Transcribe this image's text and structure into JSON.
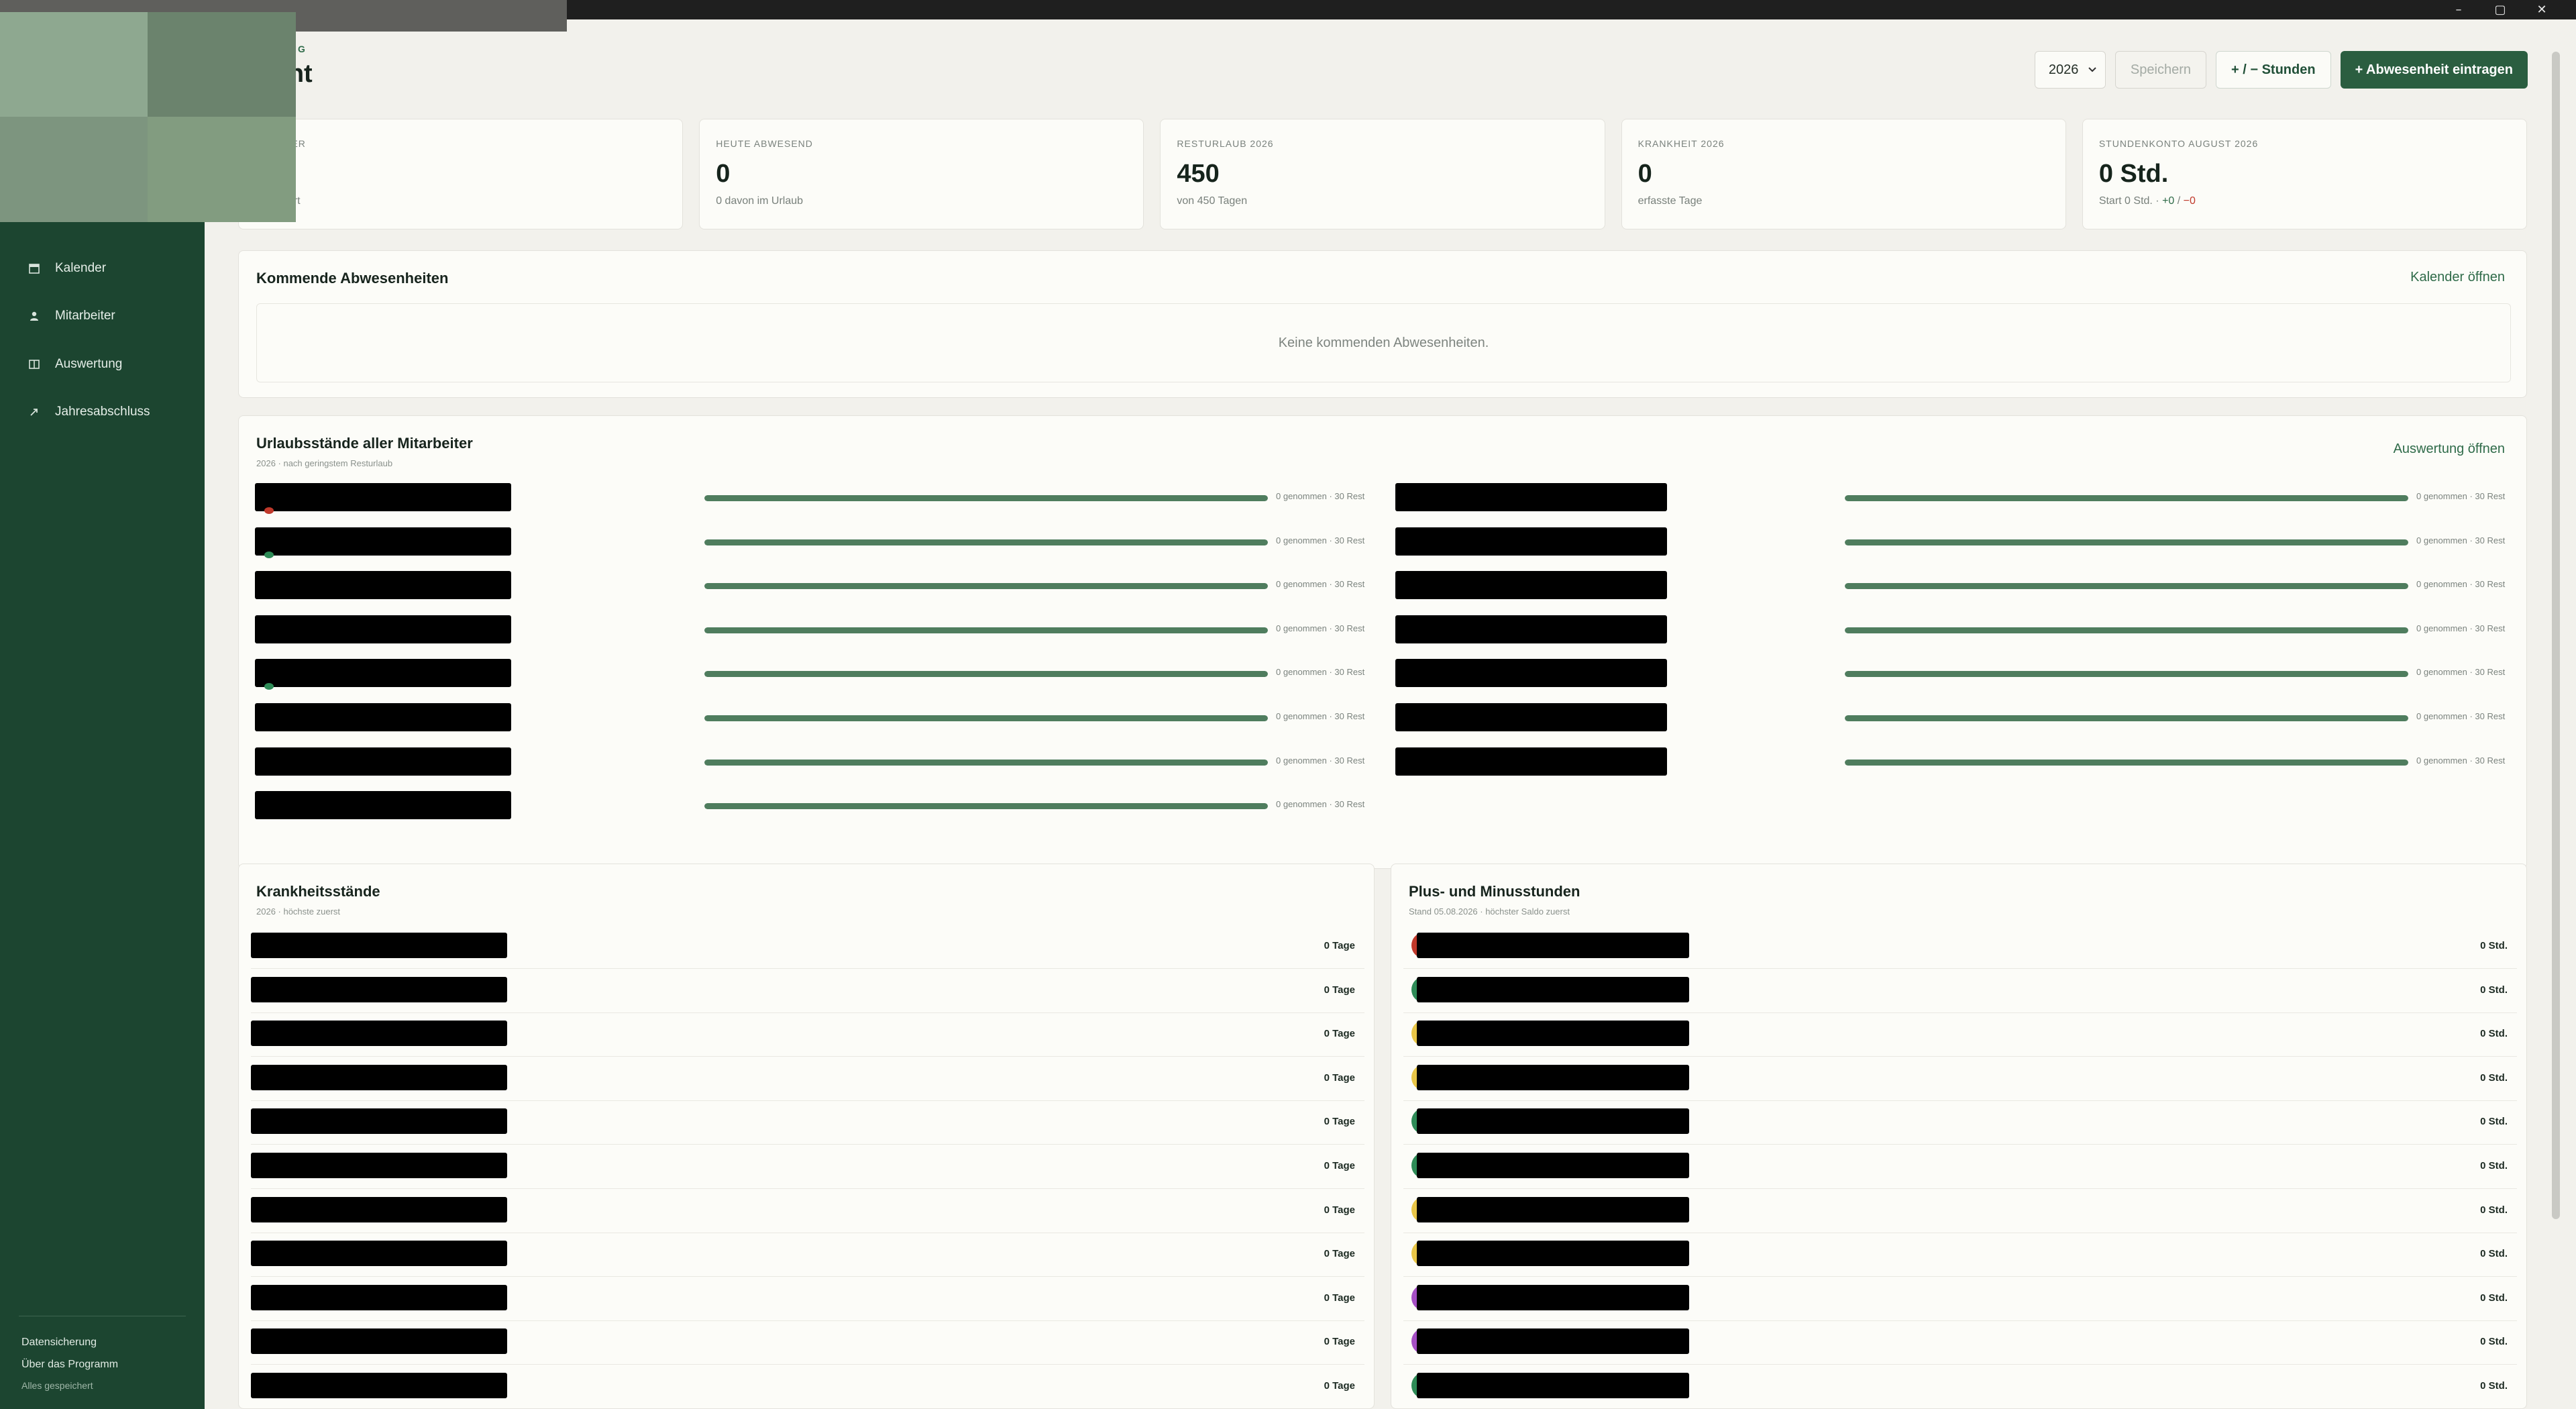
{
  "window": {
    "controls": {
      "minimize": "–",
      "maximize": "▢",
      "close": "✕"
    }
  },
  "header": {
    "eyebrow": "LANUNG",
    "title": "sicht"
  },
  "toolbar": {
    "year": "2026",
    "save_label": "Speichern",
    "hours_label": "+ / − Stunden",
    "add_absence_label": "+ Abwesenheit eintragen"
  },
  "sidebar": {
    "items": [
      {
        "label": "Kalender",
        "icon": "calendar-icon"
      },
      {
        "label": "Mitarbeiter",
        "icon": "person-icon"
      },
      {
        "label": "Auswertung",
        "icon": "columns-icon"
      },
      {
        "label": "Jahresabschluss",
        "icon": "arrow-icon"
      }
    ],
    "footer": {
      "backup_label": "Datensicherung",
      "about_label": "Über das Programm",
      "saved_status": "Alles gespeichert"
    }
  },
  "stats": [
    {
      "label": "ITER",
      "value": "",
      "sub": "ührt"
    },
    {
      "label": "HEUTE ABWESEND",
      "value": "0",
      "sub": "0 davon im Urlaub"
    },
    {
      "label": "RESTURLAUB 2026",
      "value": "450",
      "sub": "von 450 Tagen"
    },
    {
      "label": "KRANKHEIT 2026",
      "value": "0",
      "sub": "erfasste Tage"
    },
    {
      "label": "STUNDENKONTO AUGUST 2026",
      "value": "0 Std.",
      "sub_prefix": "Start 0 Std. · ",
      "sub_pos": "+0",
      "sub_sep": " / ",
      "sub_neg": "−0"
    }
  ],
  "upcoming": {
    "title": "Kommende Abwesenheiten",
    "link": "Kalender öffnen",
    "empty": "Keine kommenden Abwesenheiten."
  },
  "vacation": {
    "title": "Urlaubsstände aller Mitarbeiter",
    "subtitle": "2026 · nach geringstem Resturlaub",
    "link": "Auswertung öffnen",
    "rows": [
      {
        "text": "0 genommen · 30 Rest",
        "remaining_fraction": 1.0,
        "dot": "#c0392b"
      },
      {
        "text": "0 genommen · 30 Rest",
        "remaining_fraction": 1.0,
        "dot": "#2e8b57"
      },
      {
        "text": "0 genommen · 30 Rest",
        "remaining_fraction": 1.0,
        "dot": ""
      },
      {
        "text": "0 genommen · 30 Rest",
        "remaining_fraction": 1.0,
        "dot": ""
      },
      {
        "text": "0 genommen · 30 Rest",
        "remaining_fraction": 1.0,
        "dot": "#2e8b57"
      },
      {
        "text": "0 genommen · 30 Rest",
        "remaining_fraction": 1.0,
        "dot": ""
      },
      {
        "text": "0 genommen · 30 Rest",
        "remaining_fraction": 1.0,
        "dot": ""
      },
      {
        "text": "0 genommen · 30 Rest",
        "remaining_fraction": 1.0,
        "dot": ""
      },
      {
        "text": "0 genommen · 30 Rest",
        "remaining_fraction": 1.0,
        "dot": ""
      },
      {
        "text": "0 genommen · 30 Rest",
        "remaining_fraction": 1.0,
        "dot": ""
      },
      {
        "text": "0 genommen · 30 Rest",
        "remaining_fraction": 1.0,
        "dot": ""
      },
      {
        "text": "0 genommen · 30 Rest",
        "remaining_fraction": 1.0,
        "dot": ""
      },
      {
        "text": "0 genommen · 30 Rest",
        "remaining_fraction": 1.0,
        "dot": ""
      },
      {
        "text": "0 genommen · 30 Rest",
        "remaining_fraction": 1.0,
        "dot": ""
      },
      {
        "text": "0 genommen · 30 Rest",
        "remaining_fraction": 1.0,
        "dot": ""
      }
    ]
  },
  "sick": {
    "title": "Krankheitsstände",
    "subtitle": "2026 · höchste zuerst",
    "rows": [
      {
        "value": "0 Tage",
        "color": "#c0392b"
      },
      {
        "value": "0 Tage",
        "color": "#2e8b57"
      },
      {
        "value": "0 Tage",
        "color": "#e8c547"
      },
      {
        "value": "0 Tage",
        "color": "#e8c547"
      },
      {
        "value": "0 Tage",
        "color": "#2e8b57"
      },
      {
        "value": "0 Tage",
        "color": "#2e8b57"
      },
      {
        "value": "0 Tage",
        "color": "#e8c547"
      },
      {
        "value": "0 Tage",
        "color": "#e8c547"
      },
      {
        "value": "0 Tage",
        "color": "#a54fc4"
      },
      {
        "value": "0 Tage",
        "color": "#a54fc4"
      },
      {
        "value": "0 Tage",
        "color": "#2e8b57"
      }
    ]
  },
  "plus": {
    "title": "Plus- und Minusstunden",
    "subtitle": "Stand 05.08.2026 · höchster Saldo zuerst",
    "rows": [
      {
        "value": "0 Std.",
        "color": "#c0392b"
      },
      {
        "value": "0 Std.",
        "color": "#2e8b57"
      },
      {
        "value": "0 Std.",
        "color": "#e8c547"
      },
      {
        "value": "0 Std.",
        "color": "#e8c547"
      },
      {
        "value": "0 Std.",
        "color": "#2e8b57"
      },
      {
        "value": "0 Std.",
        "color": "#2e8b57"
      },
      {
        "value": "0 Std.",
        "color": "#e8c547"
      },
      {
        "value": "0 Std.",
        "color": "#e8c547"
      },
      {
        "value": "0 Std.",
        "color": "#a54fc4"
      },
      {
        "value": "0 Std.",
        "color": "#a54fc4"
      },
      {
        "value": "0 Std.",
        "color": "#2e8b57"
      }
    ]
  },
  "colors": {
    "sidebar_bg": "#1c4530",
    "accent": "#2b5e40",
    "bar_fill": "#4f7d5e"
  }
}
